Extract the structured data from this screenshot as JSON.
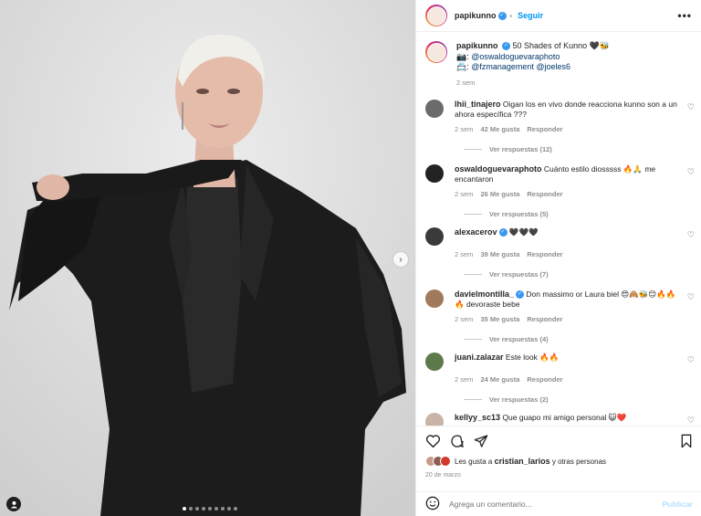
{
  "post": {
    "username": "papikunno",
    "follow_label": "Seguir",
    "more_label": "•••",
    "photo_dots": 9,
    "active_dot": 0
  },
  "caption": {
    "username": "papikunno",
    "line1": "50 Shades of Kunno 🖤🐝",
    "line2_icon": "📷:",
    "line2_link": "@oswaldoguevaraphoto",
    "line3_icon": "📇:",
    "line3_links": "@fzmanagement @joeles6",
    "time": "2 sem"
  },
  "comments": [
    {
      "user": "lhii_tinajero",
      "verified": false,
      "text": "Oigan los en vivo donde reacciona kunno son a un ahora específica ???",
      "time": "2 sem",
      "likes": "42 Me gusta",
      "reply": "Responder",
      "replies": "Ver respuestas (12)",
      "avatar_color": "#6b6b6b"
    },
    {
      "user": "oswaldoguevaraphoto",
      "verified": false,
      "text": "Cuánto estilo diosssss 🔥🙏 me encantaron",
      "time": "2 sem",
      "likes": "26 Me gusta",
      "reply": "Responder",
      "replies": "Ver respuestas (5)",
      "avatar_color": "#222222"
    },
    {
      "user": "alexacerov",
      "verified": true,
      "text": "🖤🖤🖤",
      "time": "2 sem",
      "likes": "39 Me gusta",
      "reply": "Responder",
      "replies": "Ver respuestas (7)",
      "avatar_color": "#3a3a3a"
    },
    {
      "user": "davielmontilla_",
      "verified": true,
      "text": "Don massimo or Laura biel 😍🙈🐝😊🔥🔥🔥 devoraste bebe",
      "time": "2 sem",
      "likes": "35 Me gusta",
      "reply": "Responder",
      "replies": "Ver respuestas (4)",
      "avatar_color": "#a07a5a"
    },
    {
      "user": "juani.zalazar",
      "verified": false,
      "text": "Este look 🔥🔥",
      "time": "2 sem",
      "likes": "24 Me gusta",
      "reply": "Responder",
      "replies": "Ver respuestas (2)",
      "avatar_color": "#5d7a4a"
    },
    {
      "user": "kellyy_sc13",
      "verified": false,
      "text": "Que guapo mi amigo personal 😺❤️",
      "time": "",
      "likes": "",
      "reply": "",
      "replies": "",
      "avatar_color": "#c9b4a8"
    }
  ],
  "actions": {
    "likes_prefix": "Les gusta a",
    "likes_user": "cristian_larios",
    "likes_suffix": "y otras personas",
    "date": "20 de marzo"
  },
  "composer": {
    "placeholder": "Agrega un comentario...",
    "publish_label": "Publicar"
  },
  "icons": {
    "like": "heart-icon",
    "comment": "comment-icon",
    "share": "share-icon",
    "save": "bookmark-icon",
    "emoji": "emoji-icon",
    "tag": "person-tag-icon",
    "next": "chevron-right-icon"
  },
  "colors": {
    "link": "#00376b",
    "follow": "#0095f6",
    "verified": "#3897f0",
    "muted": "#8e8e8e"
  }
}
